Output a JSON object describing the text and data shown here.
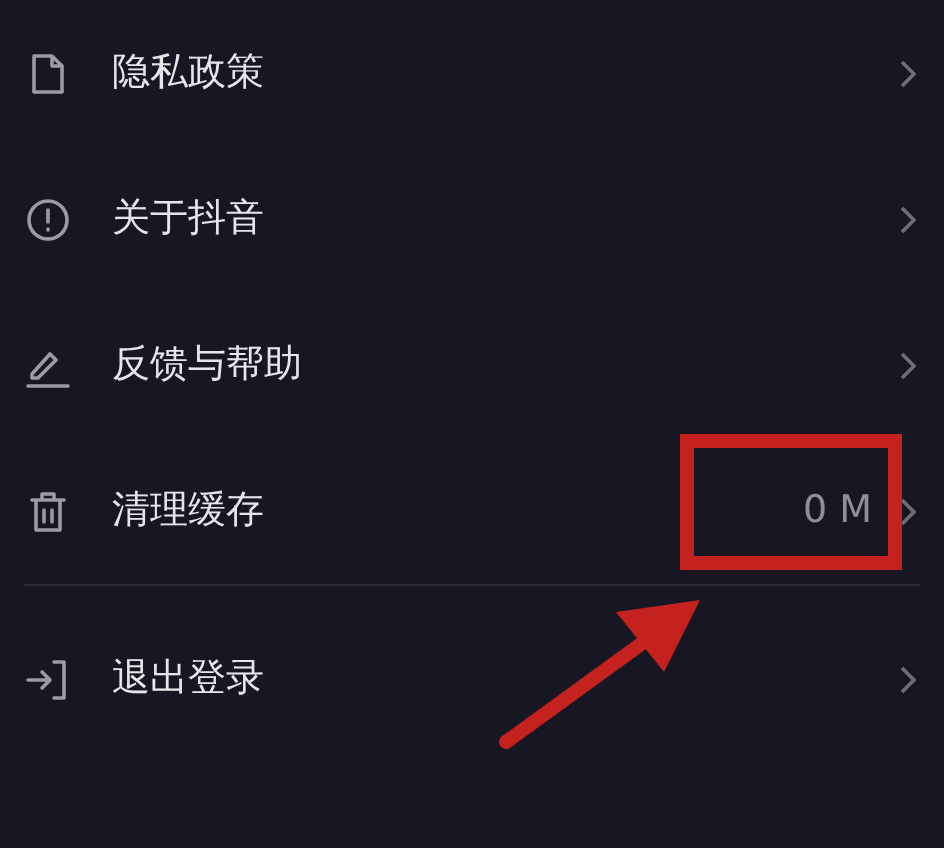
{
  "sections": [
    {
      "items": [
        {
          "kind": "document",
          "label": "隐私政策"
        },
        {
          "kind": "info",
          "label": "关于抖音"
        },
        {
          "kind": "edit",
          "label": "反馈与帮助"
        },
        {
          "kind": "trash",
          "label": "清理缓存",
          "value": "0 M"
        }
      ]
    },
    {
      "items": [
        {
          "kind": "logout",
          "label": "退出登录"
        }
      ]
    }
  ],
  "annotation": {
    "kind": "box_and_arrow"
  }
}
